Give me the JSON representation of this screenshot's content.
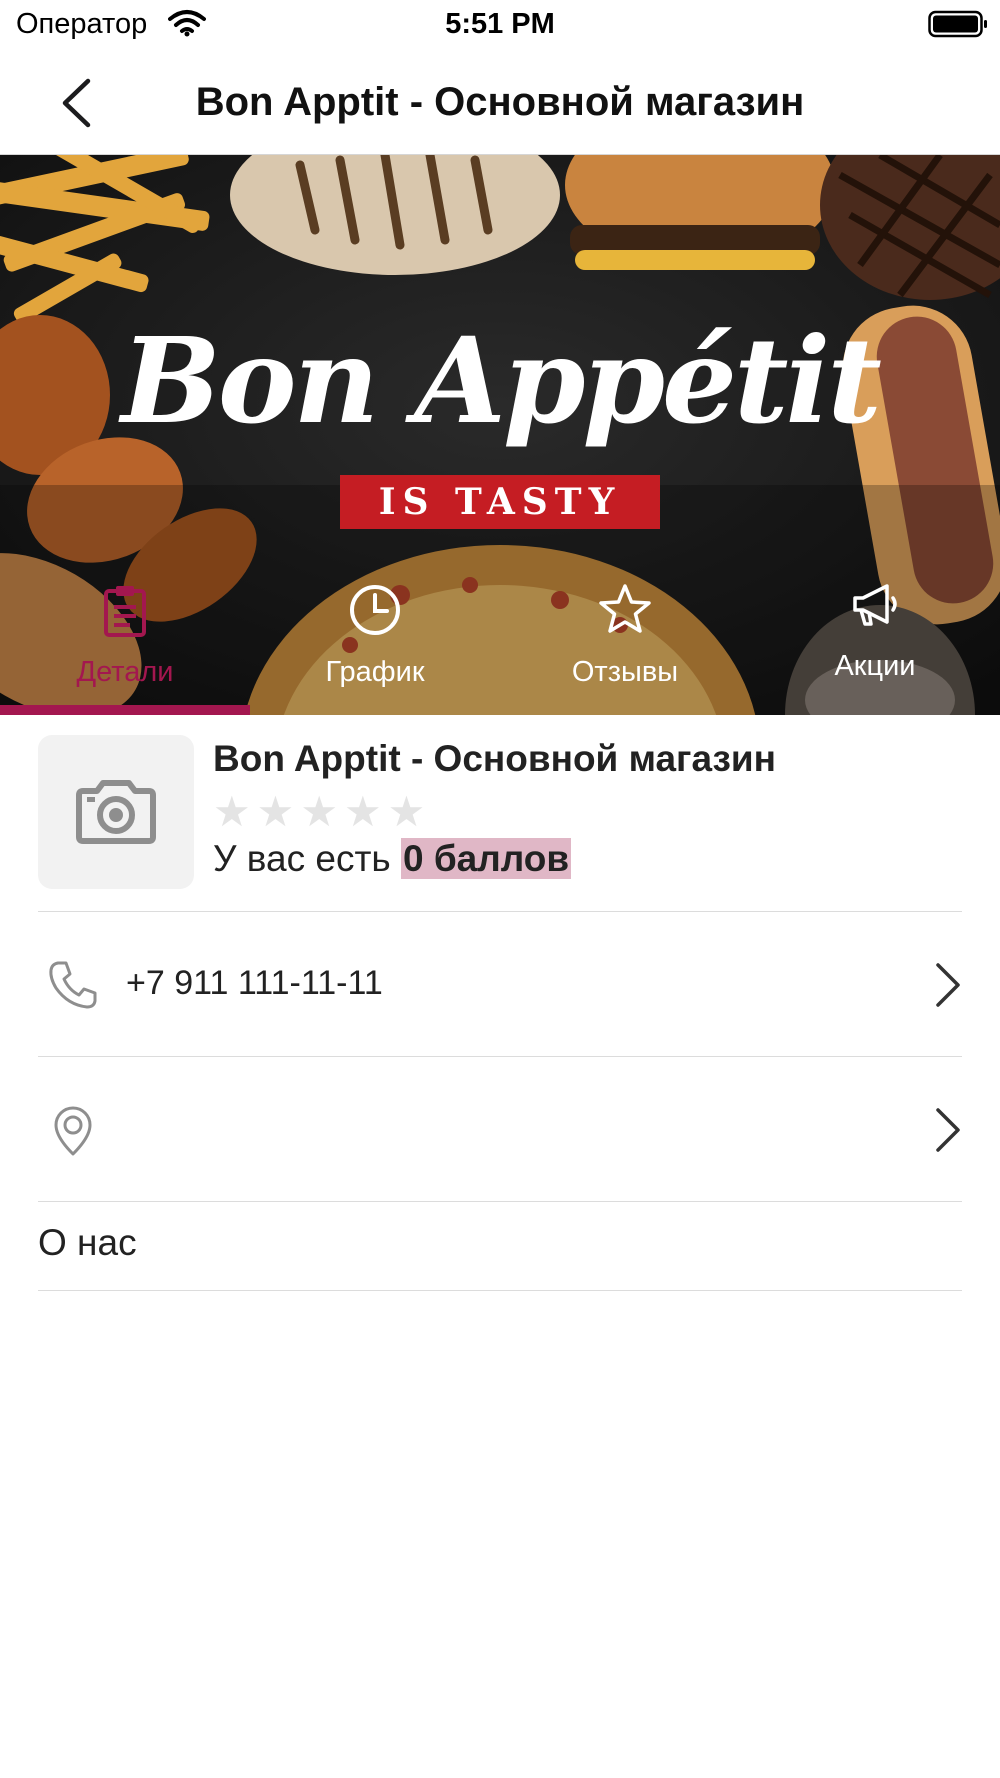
{
  "status_bar": {
    "carrier": "Оператор",
    "time": "5:51 PM"
  },
  "nav": {
    "title": "Bon Apptit - Основной магазин"
  },
  "banner": {
    "brand": "Bon Appétit",
    "tagline": "IS TASTY"
  },
  "tabs": [
    {
      "label": "Детали",
      "icon": "clipboard-icon",
      "active": true
    },
    {
      "label": "График",
      "icon": "clock-icon",
      "active": false
    },
    {
      "label": "Отзывы",
      "icon": "star-icon",
      "active": false
    },
    {
      "label": "Акции",
      "icon": "megaphone-icon",
      "active": false
    }
  ],
  "store": {
    "name": "Bon Apptit - Основной магазин",
    "rating": 0,
    "rating_max": 5,
    "points_prefix": "У вас есть",
    "points_value": "0 баллов"
  },
  "contacts": {
    "phone": "+7 911 111-11-11",
    "address": ""
  },
  "about_label": "О нас",
  "colors": {
    "accent": "#a3174f",
    "points_highlight": "#e0b7c6",
    "banner_tag": "#c51d23"
  }
}
